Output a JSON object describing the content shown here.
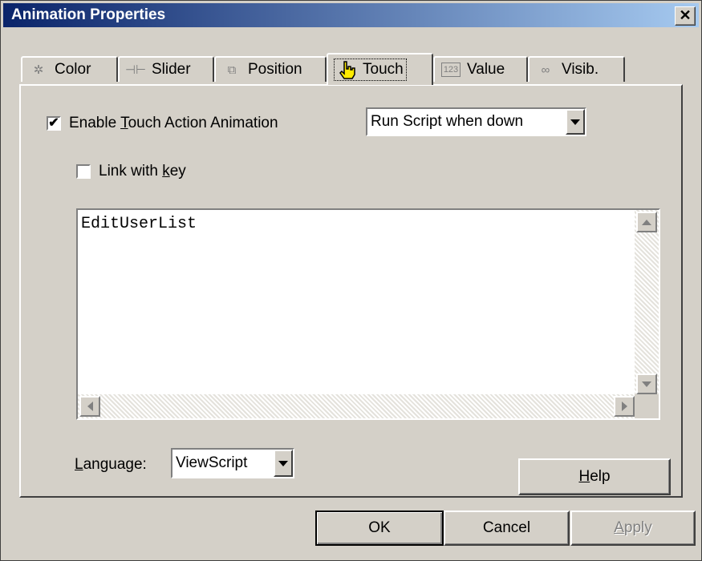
{
  "window": {
    "title": "Animation Properties",
    "close_glyph": "✕"
  },
  "tabs": [
    {
      "label": "Color",
      "icon": "color-wheel-icon",
      "glyph": "✲"
    },
    {
      "label": "Slider",
      "icon": "slider-icon",
      "glyph": "⊣⊢"
    },
    {
      "label": "Position",
      "icon": "position-icon",
      "glyph": "⧉"
    },
    {
      "label": "Touch",
      "icon": "hand-pointer-icon",
      "glyph": "☝",
      "active": true
    },
    {
      "label": "Value",
      "icon": "value-123-icon",
      "glyph": "123"
    },
    {
      "label": "Visib.",
      "icon": "glasses-icon",
      "glyph": "∞"
    }
  ],
  "touch": {
    "enable_label_pre": "Enable ",
    "enable_label_key": "T",
    "enable_label_post": "ouch Action Animation",
    "enable_checked": true,
    "check_glyph": "✔",
    "action_select_value": "Run Script when down",
    "link_label_pre": "Link with ",
    "link_label_key": "k",
    "link_label_post": "ey",
    "link_checked": false,
    "script_text": "EditUserList",
    "language_label_pre": "",
    "language_label_key": "L",
    "language_label_post": "anguage:",
    "language_value": "ViewScript",
    "help_key": "H",
    "help_rest": "elp"
  },
  "footer": {
    "ok_label": "OK",
    "cancel_label": "Cancel",
    "apply_key": "A",
    "apply_rest": "pply"
  }
}
